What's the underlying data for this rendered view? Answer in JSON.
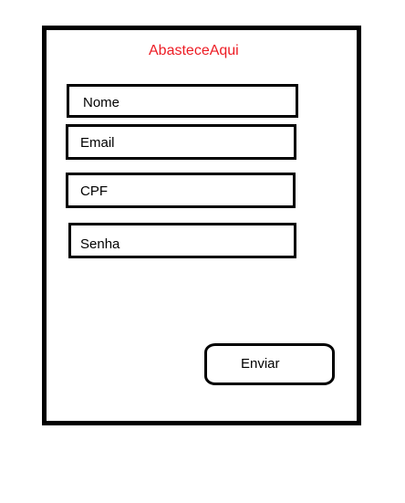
{
  "app": {
    "title": "AbasteceAqui"
  },
  "form": {
    "fields": [
      {
        "label": "Nome"
      },
      {
        "label": "Email"
      },
      {
        "label": "CPF"
      },
      {
        "label": "Senha"
      }
    ],
    "submit_label": "Enviar"
  },
  "colors": {
    "title": "#ed1c24",
    "border": "#000000",
    "background": "#ffffff"
  }
}
